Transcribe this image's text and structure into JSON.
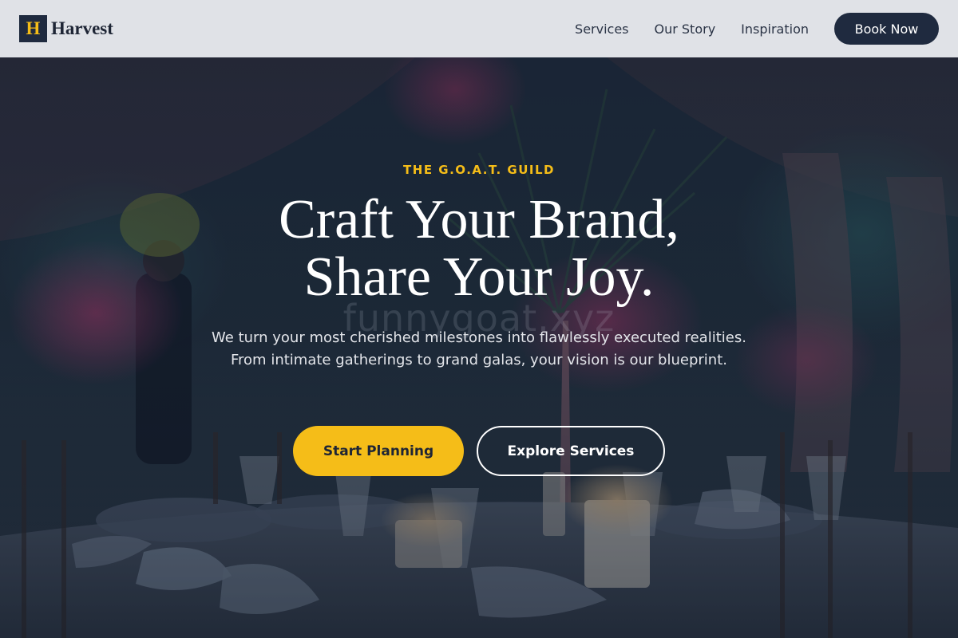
{
  "brand": {
    "logo_letter": "H",
    "name": "Harvest"
  },
  "nav": {
    "items": [
      {
        "label": "Services"
      },
      {
        "label": "Our Story"
      },
      {
        "label": "Inspiration"
      }
    ],
    "cta_label": "Book Now"
  },
  "hero": {
    "eyebrow": "THE G.O.A.T. GUILD",
    "headline_line1": "Craft Your Brand,",
    "headline_line2": "Share Your Joy.",
    "watermark": "funnygoat.xyz",
    "subtext": "We turn your most cherished milestones into flawlessly executed realities. From intimate gatherings to grand galas, your vision is our blueprint.",
    "primary_cta": "Start Planning",
    "secondary_cta": "Explore Services"
  },
  "colors": {
    "accent": "#f5bd18",
    "navy": "#1f2a3f",
    "header_bg": "#e8eaee",
    "text_light": "#ffffff"
  }
}
